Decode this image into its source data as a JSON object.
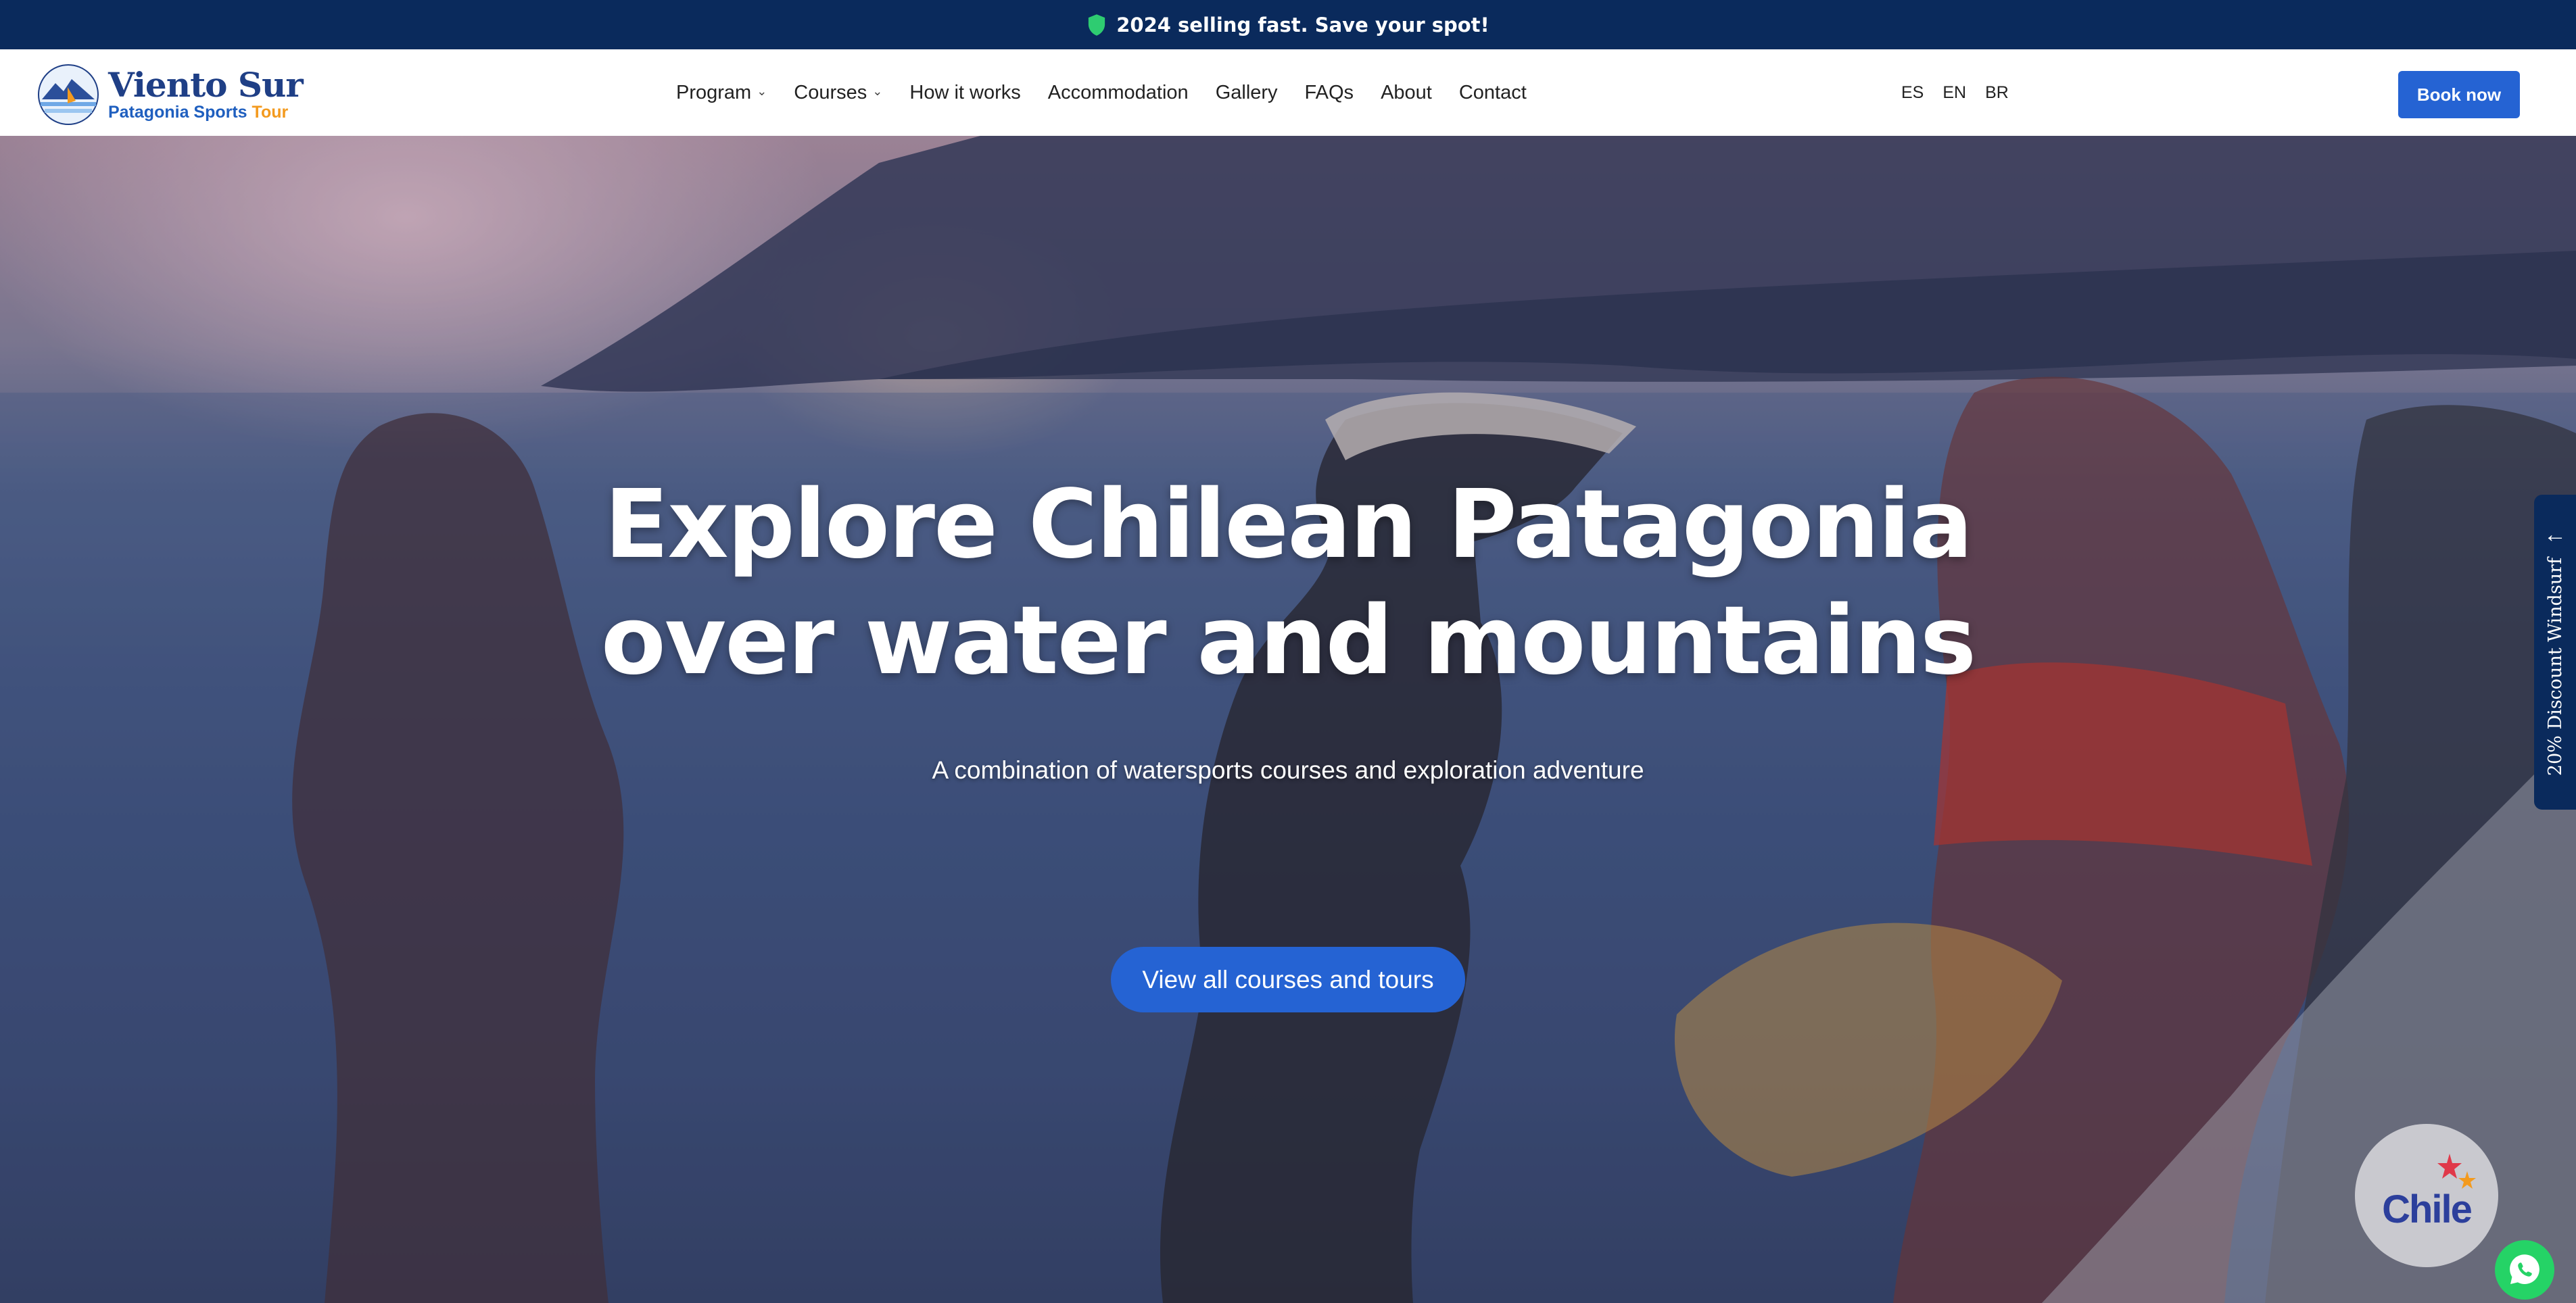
{
  "announcement": {
    "text": "2024 selling fast. Save your spot!",
    "icon": "shield-icon"
  },
  "brand": {
    "title": "Viento Sur",
    "subtitle_main": "Patagonia Sports",
    "subtitle_accent": "Tour"
  },
  "nav": {
    "items": [
      {
        "label": "Program",
        "dropdown": true
      },
      {
        "label": "Courses",
        "dropdown": true
      },
      {
        "label": "How it works",
        "dropdown": false
      },
      {
        "label": "Accommodation",
        "dropdown": false
      },
      {
        "label": "Gallery",
        "dropdown": false
      },
      {
        "label": "FAQs",
        "dropdown": false
      },
      {
        "label": "About",
        "dropdown": false
      },
      {
        "label": "Contact",
        "dropdown": false
      }
    ]
  },
  "languages": [
    "ES",
    "EN",
    "BR"
  ],
  "book_button": "Book now",
  "hero": {
    "title_line1": "Explore Chilean Patagonia",
    "title_line2": "over water and mountains",
    "subtitle": "A combination of watersports courses and exploration adventure",
    "cta": "View all courses and tours"
  },
  "side_tab": {
    "text": "20% Discount Windsurf",
    "icon": "arrow-left-icon"
  },
  "chile_badge": {
    "text": "Chile"
  },
  "colors": {
    "topbar": "#0a2a5c",
    "primary": "#2563d3",
    "brand_dark": "#1f3f86",
    "brand_accent": "#f39a1e",
    "whatsapp": "#25d366"
  }
}
